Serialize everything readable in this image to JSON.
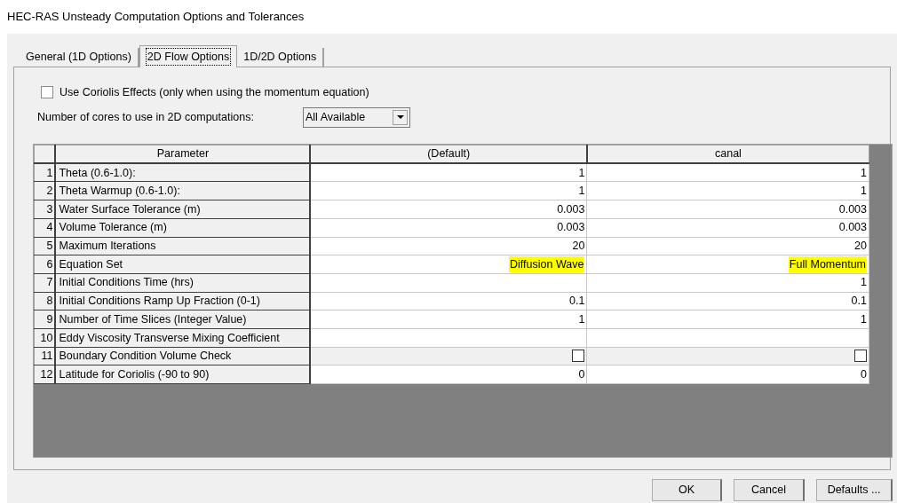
{
  "window": {
    "title": "HEC-RAS Unsteady Computation Options and Tolerances"
  },
  "tabs": [
    {
      "label": "General (1D Options)",
      "selected": false
    },
    {
      "label": "2D Flow Options",
      "selected": true
    },
    {
      "label": "1D/2D Options",
      "selected": false
    }
  ],
  "coriolis": {
    "label": "Use Coriolis Effects (only when using the momentum equation)",
    "checked": false
  },
  "cores": {
    "label": "Number of cores to use in 2D computations:",
    "value": "All Available"
  },
  "table": {
    "columns": [
      "Parameter",
      "(Default)",
      "canal"
    ],
    "rows": [
      {
        "number": "1",
        "parameter": "Theta  (0.6-1.0):",
        "values": [
          {
            "kind": "text",
            "text": "1",
            "highlighted": false
          },
          {
            "kind": "text",
            "text": "1",
            "highlighted": false
          }
        ]
      },
      {
        "number": "2",
        "parameter": "Theta Warmup  (0.6-1.0):",
        "values": [
          {
            "kind": "text",
            "text": "1",
            "highlighted": false
          },
          {
            "kind": "text",
            "text": "1",
            "highlighted": false
          }
        ]
      },
      {
        "number": "3",
        "parameter": "Water Surface Tolerance (m)",
        "values": [
          {
            "kind": "text",
            "text": "0.003",
            "highlighted": false
          },
          {
            "kind": "text",
            "text": "0.003",
            "highlighted": false
          }
        ]
      },
      {
        "number": "4",
        "parameter": "Volume Tolerance (m)",
        "values": [
          {
            "kind": "text",
            "text": "0.003",
            "highlighted": false
          },
          {
            "kind": "text",
            "text": "0.003",
            "highlighted": false
          }
        ]
      },
      {
        "number": "5",
        "parameter": "Maximum Iterations",
        "values": [
          {
            "kind": "text",
            "text": "20",
            "highlighted": false
          },
          {
            "kind": "text",
            "text": "20",
            "highlighted": false
          }
        ]
      },
      {
        "number": "6",
        "parameter": "Equation Set",
        "values": [
          {
            "kind": "text",
            "text": "Diffusion Wave",
            "highlighted": true
          },
          {
            "kind": "text",
            "text": "Full Momentum",
            "highlighted": true
          }
        ]
      },
      {
        "number": "7",
        "parameter": "Initial Conditions Time (hrs)",
        "values": [
          {
            "kind": "blank"
          },
          {
            "kind": "text",
            "text": "1",
            "highlighted": false
          }
        ]
      },
      {
        "number": "8",
        "parameter": "Initial Conditions Ramp Up Fraction (0-1)",
        "values": [
          {
            "kind": "text",
            "text": "0.1",
            "highlighted": false
          },
          {
            "kind": "text",
            "text": "0.1",
            "highlighted": false
          }
        ]
      },
      {
        "number": "9",
        "parameter": "Number of Time Slices (Integer Value)",
        "values": [
          {
            "kind": "text",
            "text": "1",
            "highlighted": false
          },
          {
            "kind": "text",
            "text": "1",
            "highlighted": false
          }
        ]
      },
      {
        "number": "10",
        "parameter": "Eddy Viscosity Transverse Mixing Coefficient",
        "values": [
          {
            "kind": "blank"
          },
          {
            "kind": "blank"
          }
        ]
      },
      {
        "number": "11",
        "parameter": "Boundary Condition Volume Check",
        "values": [
          {
            "kind": "checkbox",
            "checked": false
          },
          {
            "kind": "checkbox",
            "checked": false
          }
        ]
      },
      {
        "number": "12",
        "parameter": "Latitude for Coriolis (-90 to 90)",
        "values": [
          {
            "kind": "text",
            "text": "0",
            "highlighted": false
          },
          {
            "kind": "text",
            "text": "0",
            "highlighted": false
          }
        ]
      }
    ]
  },
  "buttons": [
    "OK",
    "Cancel",
    "Defaults ..."
  ]
}
